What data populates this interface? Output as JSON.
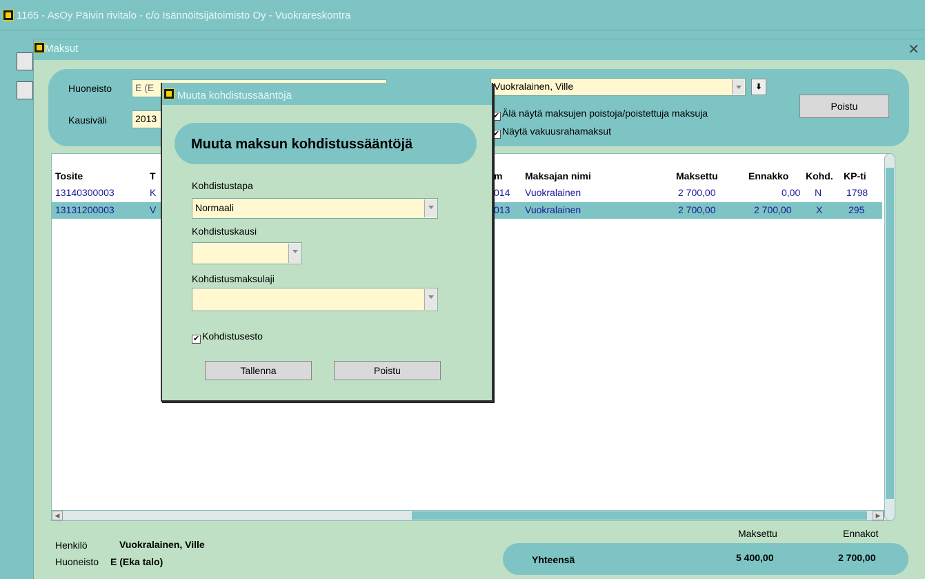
{
  "app": {
    "title": "1165 - AsOy Päivin  rivitalo - c/o Isännöitsijätoimisto Oy - Vuokrareskontra"
  },
  "maksut_window": {
    "title": "Maksut",
    "filters": {
      "huoneisto_label": "Huoneisto",
      "huoneisto_value": "E (E",
      "kausivali_label": "Kausiväli",
      "kausivali_value": "2013",
      "maksaja_value": "Vuokralainen, Ville",
      "chk_poistot_label": "Älä näytä maksujen poistoja/poistettuja maksuja",
      "chk_vakuus_label": "Näytä vakuusrahamaksut",
      "poistu_label": "Poistu"
    },
    "table": {
      "headers": [
        "Tosite",
        "T",
        "m",
        "Maksajan nimi",
        "Maksettu",
        "Ennakko",
        "Kohd.",
        "KP-ti"
      ],
      "rows": [
        {
          "tosite": "13140300003",
          "t": "K",
          "m": "014",
          "nimi": "Vuokralainen",
          "maksettu": "2 700,00",
          "ennakko": "0,00",
          "kohd": "N",
          "kp": "1798"
        },
        {
          "tosite": "13131200003",
          "t": "V",
          "m": "013",
          "nimi": "Vuokralainen",
          "maksettu": "2 700,00",
          "ennakko": "2 700,00",
          "kohd": "X",
          "kp": "295"
        }
      ]
    },
    "footer": {
      "henkilo_label": "Henkilö",
      "henkilo_value": "Vuokralainen, Ville",
      "huoneisto_label": "Huoneisto",
      "huoneisto_value": "E (Eka talo)",
      "maksettu_label": "Maksettu",
      "ennakot_label": "Ennakot",
      "yhteensa_label": "Yhteensä",
      "maksettu_total": "5 400,00",
      "ennakot_total": "2 700,00"
    }
  },
  "dialog": {
    "title": "Muuta kohdistussääntöjä",
    "heading": "Muuta maksun kohdistussääntöjä",
    "kohdistustapa_label": "Kohdistustapa",
    "kohdistustapa_value": "Normaali",
    "kohdistuskausi_label": "Kohdistuskausi",
    "kohdistuskausi_value": "",
    "kohdistusmaksulaji_label": "Kohdistusmaksulaji",
    "kohdistusmaksulaji_value": "",
    "kohdistusesto_label": "Kohdistusesto",
    "tallenna_label": "Tallenna",
    "poistu_label": "Poistu"
  },
  "colors": {
    "background": "#7fc4c4",
    "panel": "#bfe0c4",
    "field": "#fff8d0",
    "row_text": "#1a1a9a"
  }
}
